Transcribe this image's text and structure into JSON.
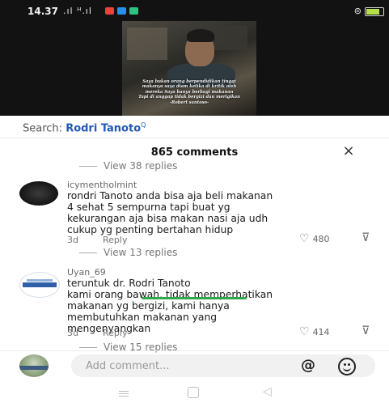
{
  "status_bar": {
    "time": "14.37",
    "network": ".ıl ᴴ.ıl",
    "battery_level": 0.8,
    "app_colors": [
      "#e8443a",
      "#2a8de8",
      "#2ec27e"
    ]
  },
  "video": {
    "caption_lines": [
      "Saya bukan orang berpendidikan tinggi",
      "makanya saya diam ketika di kritik oleh",
      "mereka Saya hanya berbagi makanan",
      "Tapi di anggap tidak bergizi dan merigikan",
      "-Robert santoso-"
    ]
  },
  "search": {
    "label": "Search: ",
    "query": "Rodri Tanoto",
    "query_suffix": "Q"
  },
  "comments_panel": {
    "title": "865 comments",
    "close_icon": "×",
    "top_view_replies": "View 38 replies",
    "comments": [
      {
        "username": "icymentholmint",
        "lines": [
          "rondri Tanoto anda bisa aja beli makanan",
          "4 sehat 5 sempurna tapi buat yg",
          "kekurangan aja bisa makan nasi aja udh",
          "cukup yg penting bertahan hidup"
        ],
        "age": "3d",
        "reply_label": "Reply",
        "likes": "480",
        "view_replies": "View 13 replies"
      },
      {
        "username": "Uyan_69",
        "lines": [
          "teruntuk dr. Rodri Tanoto",
          "kami orang bawah, tidak memperhatikan",
          "makanan yg bergizi, kami hanya",
          "membutuhkan makanan yang",
          "mengenyangkan"
        ],
        "age": "3d",
        "reply_label": "Reply",
        "likes": "414",
        "view_replies": "View 15 replies"
      }
    ]
  },
  "composer": {
    "placeholder": "Add comment...",
    "mention_icon": "@"
  },
  "nav": {
    "back_icon": "◁"
  }
}
